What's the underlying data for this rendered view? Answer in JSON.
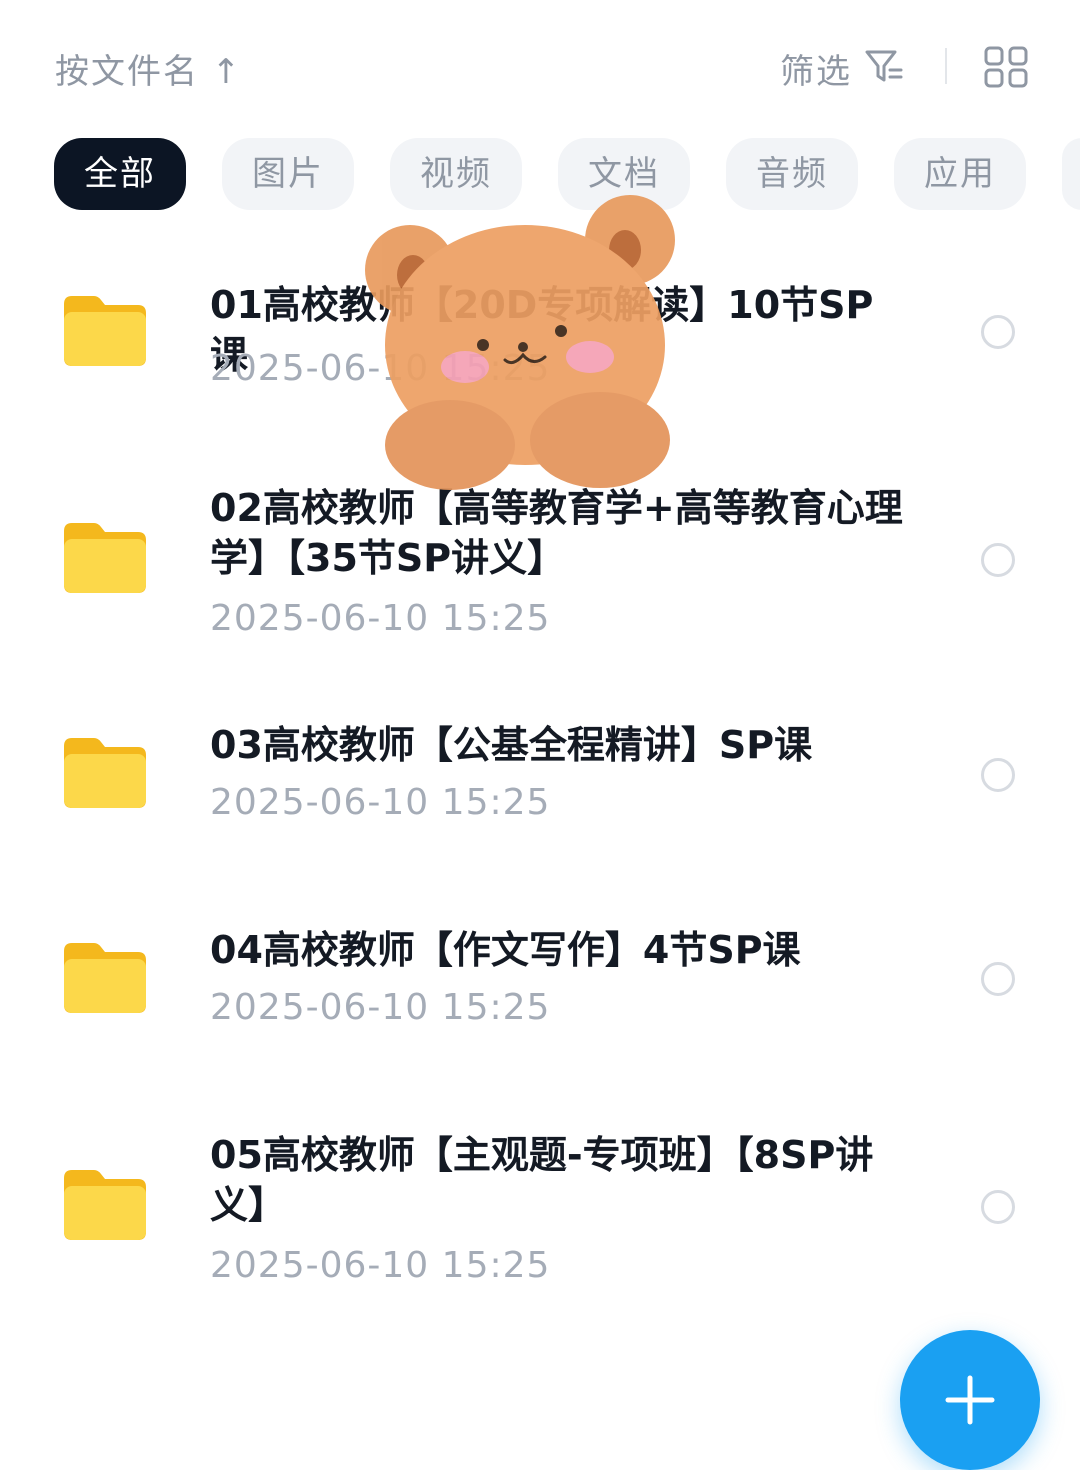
{
  "toolbar": {
    "sort_label": "按文件名 ↑",
    "filter_label": "筛选",
    "filter_icon": "filter-icon",
    "view_icon": "grid-view-icon"
  },
  "tabs": [
    {
      "label": "全部",
      "active": true
    },
    {
      "label": "图片",
      "active": false
    },
    {
      "label": "视频",
      "active": false
    },
    {
      "label": "文档",
      "active": false
    },
    {
      "label": "音频",
      "active": false
    },
    {
      "label": "应用",
      "active": false
    }
  ],
  "files": [
    {
      "name": "01高校教师【20D专项解读】10节SP课",
      "date": "2025-06-10  15:25",
      "icon": "folder-icon"
    },
    {
      "name": "02高校教师【高等教育学+高等教育心理学】【35节SP讲义】",
      "date": "2025-06-10  15:25",
      "icon": "folder-icon"
    },
    {
      "name": "03高校教师【公基全程精讲】SP课",
      "date": "2025-06-10  15:25",
      "icon": "folder-icon"
    },
    {
      "name": "04高校教师【作文写作】4节SP课",
      "date": "2025-06-10  15:25",
      "icon": "folder-icon"
    },
    {
      "name": "05高校教师【主观题-专项班】【8SP讲义】",
      "date": "2025-06-10  15:25",
      "icon": "folder-icon"
    }
  ],
  "fab": {
    "icon": "plus-icon"
  },
  "colors": {
    "active_tab_bg": "#0c1524",
    "folder_yellow": "#f9cc3a",
    "fab_blue": "#1aa0f2"
  }
}
